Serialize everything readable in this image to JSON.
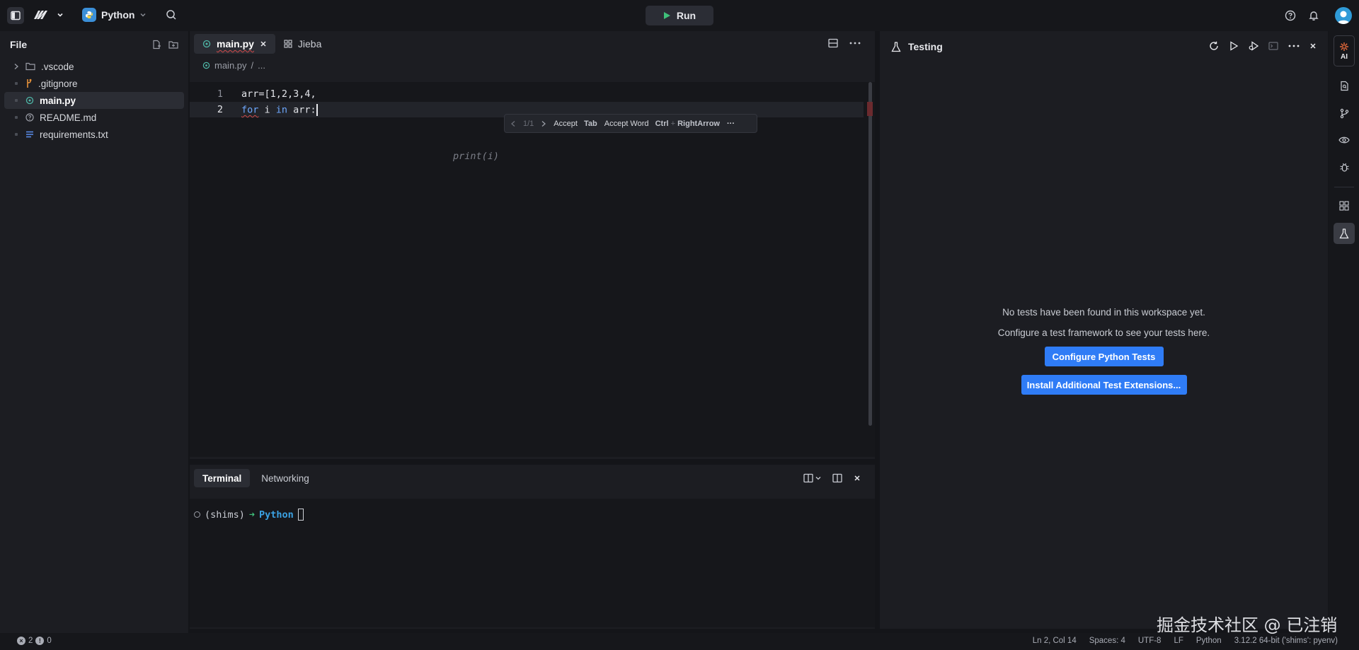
{
  "topbar": {
    "repl_name": "Python",
    "run_label": "Run"
  },
  "files": {
    "title": "File",
    "items": [
      {
        "name": ".vscode",
        "type": "folder"
      },
      {
        "name": ".gitignore",
        "type": "git"
      },
      {
        "name": "main.py",
        "type": "python",
        "active": true
      },
      {
        "name": "README.md",
        "type": "markdown"
      },
      {
        "name": "requirements.txt",
        "type": "text"
      }
    ]
  },
  "editor": {
    "tabs": [
      {
        "label": "main.py",
        "active": true
      },
      {
        "label": "Jieba",
        "active": false
      }
    ],
    "breadcrumb": {
      "file": "main.py",
      "sep": "/",
      "more": "..."
    },
    "lines": [
      {
        "num": "1",
        "code": "arr=[1,2,3,4,"
      },
      {
        "num": "2",
        "code_kw": "for",
        "code_rest": " i ",
        "code_kw2": "in",
        "code_rest2": " arr:"
      }
    ],
    "ghost": "print(i)",
    "suggest": {
      "counter": "1/1",
      "accept": "Accept",
      "accept_key": "Tab",
      "accept_word": "Accept Word",
      "accept_word_key_1": "Ctrl",
      "accept_word_plus": "+",
      "accept_word_key_2": "RightArrow",
      "more": "···"
    }
  },
  "terminal": {
    "tabs": [
      {
        "label": "Terminal",
        "active": true
      },
      {
        "label": "Networking",
        "active": false
      }
    ],
    "prompt_env": "(shims)",
    "prompt_arrow": "➜",
    "prompt_dir": "Python"
  },
  "testing": {
    "title": "Testing",
    "empty_message": "No tests have been found in this workspace yet.",
    "hint": "Configure a test framework to see your tests here.",
    "configure_button": "Configure Python Tests",
    "install_button": "Install Additional Test Extensions..."
  },
  "activity": {
    "ai_label": "AI"
  },
  "status": {
    "errors": "2",
    "warnings": "0",
    "position": "Ln 2, Col 14",
    "spaces": "Spaces: 4",
    "encoding": "UTF-8",
    "eol": "LF",
    "language": "Python",
    "interpreter": "3.12.2 64-bit ('shims': pyenv)"
  },
  "watermark": "掘金技术社区 @ 已注销",
  "colors": {
    "accent": "#2f7cf6",
    "background": "#16171b",
    "panel": "#1c1d22",
    "keyword": "#6ea9ff",
    "prompt_arrow": "#3fc07a",
    "prompt_dir": "#3ba2e3"
  }
}
